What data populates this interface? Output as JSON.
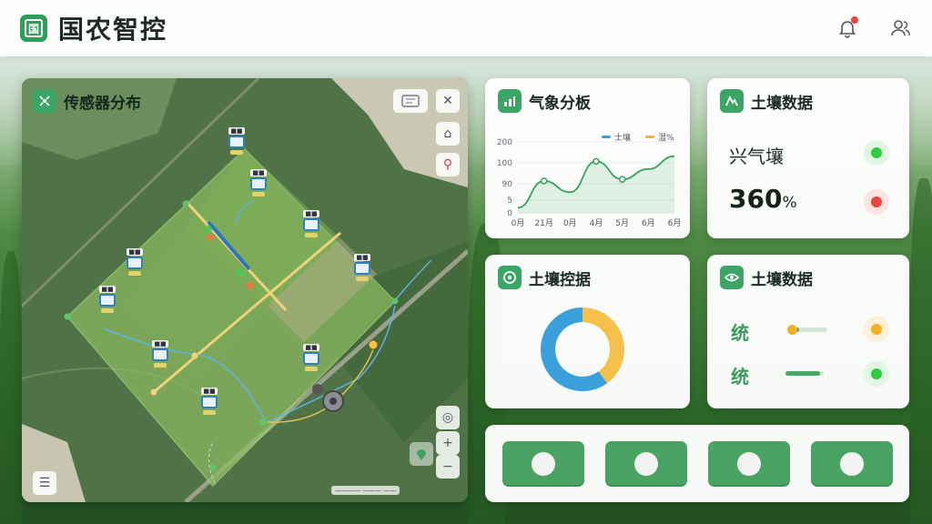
{
  "app": {
    "title": "国农智控"
  },
  "map_panel": {
    "title": "传感器分布"
  },
  "weather": {
    "title": "气象分板",
    "legend": [
      {
        "name": "士壤",
        "color": "#3a9fd6"
      },
      {
        "name": "湿%",
        "color": "#f2b134"
      }
    ]
  },
  "soil_top": {
    "title": "土壤数据",
    "row1_label": "兴气壤",
    "row1_status_color": "#2ecc40",
    "value": "360",
    "unit": "%",
    "row2_status_color": "#e8453c"
  },
  "soil_control": {
    "title": "土壤控据"
  },
  "soil_bottom": {
    "title": "土壤数据",
    "items": [
      {
        "label": "统",
        "level": 0.25,
        "status_color": "#f3b026"
      },
      {
        "label": "统",
        "level": 0.9,
        "status_color": "#2ecc40"
      }
    ]
  },
  "controls": {
    "count": 4
  },
  "chart_data": {
    "type": "line",
    "categories": [
      "0月",
      "21月",
      "0月",
      "4月",
      "5月",
      "6月",
      "6月"
    ],
    "yticks": [
      "200",
      "100",
      "90",
      "5",
      "0"
    ],
    "series": [
      {
        "values": [
          10,
          62,
          40,
          100,
          65,
          85,
          110
        ]
      }
    ],
    "ylim": [
      0,
      200
    ],
    "grid": true,
    "legend_position": "top-right"
  },
  "donut": {
    "type": "pie",
    "values": [
      40,
      60
    ],
    "colors": [
      "#f5c04c",
      "#3aa0dc"
    ]
  }
}
